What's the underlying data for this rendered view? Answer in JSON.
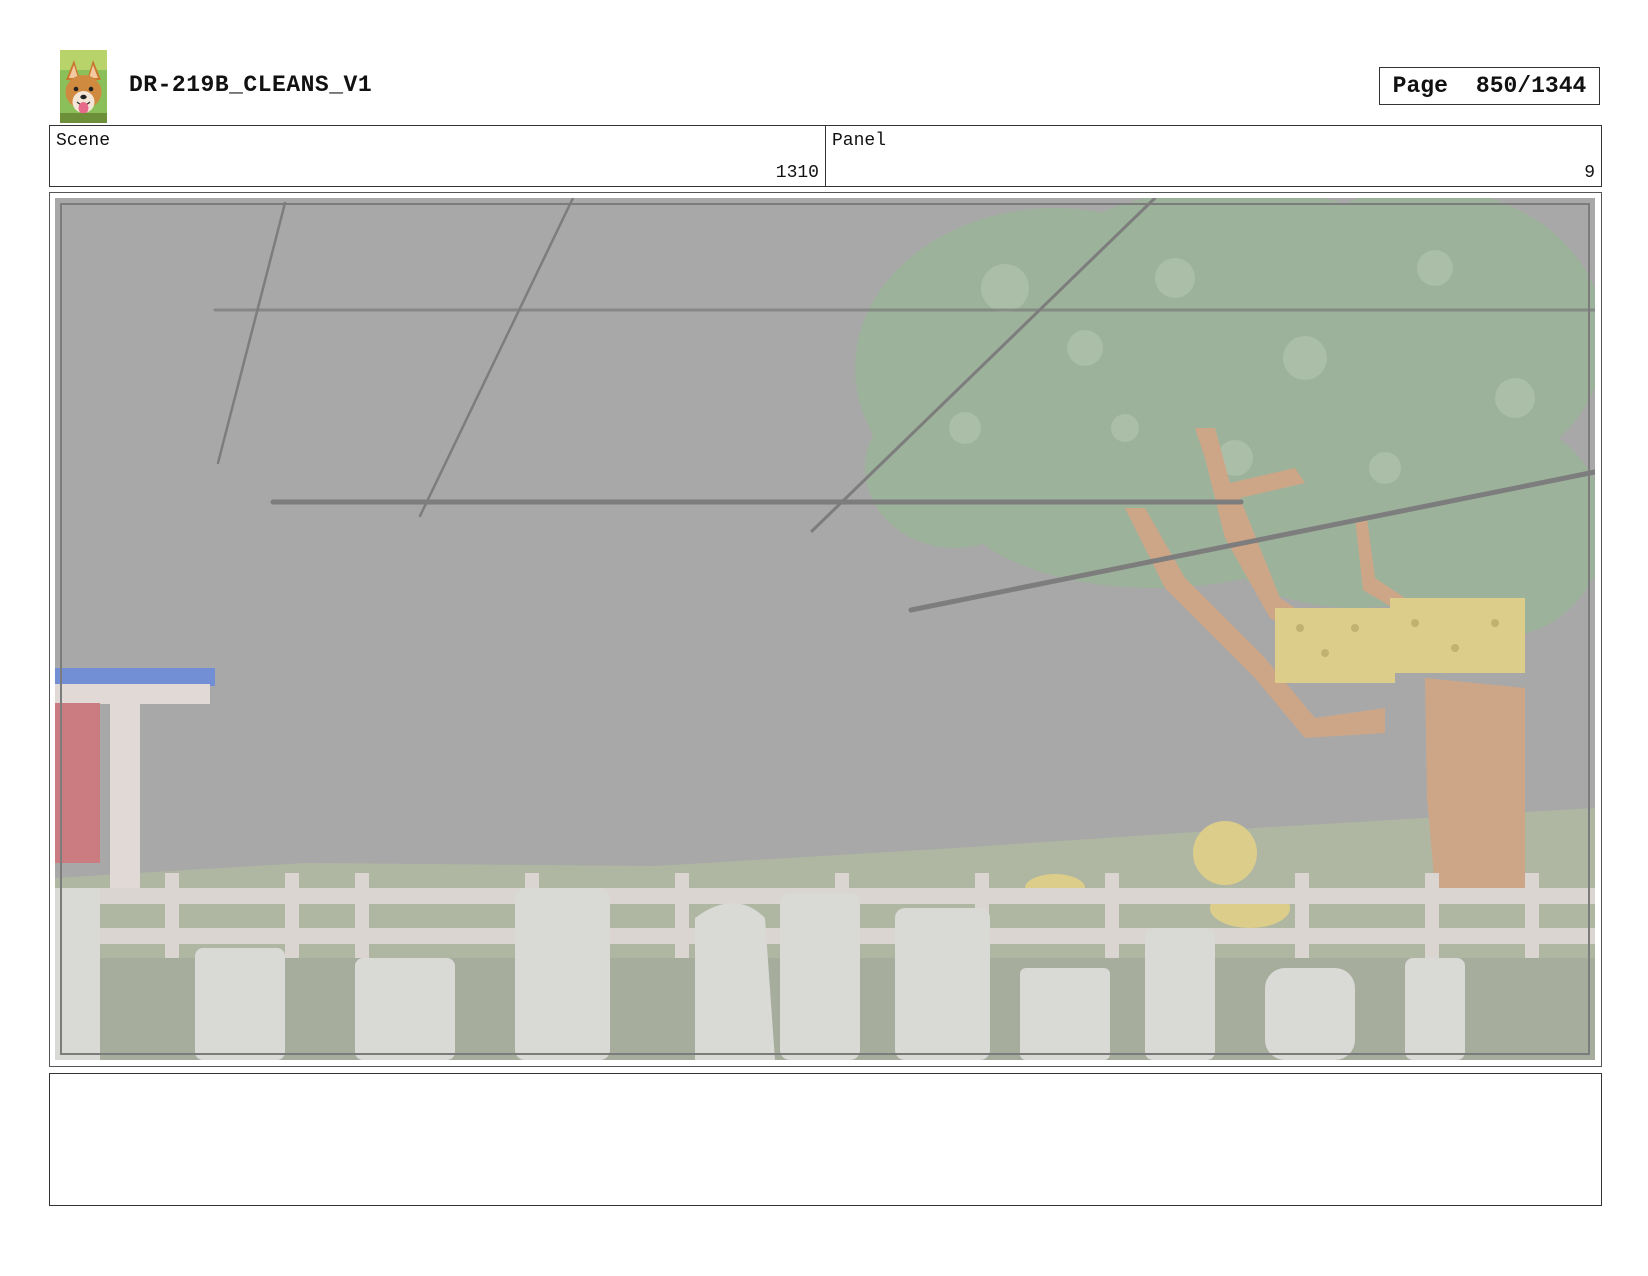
{
  "header": {
    "project_title": "DR-219B_CLEANS_V1",
    "page_label": "Page",
    "page_number": "850/1344"
  },
  "info": {
    "scene_label": "Scene",
    "scene_value": "1310",
    "panel_label": "Panel",
    "panel_value": "9"
  },
  "notes": {
    "text": ""
  },
  "colors": {
    "sky": "#9d9d9d",
    "grass": "#a4ad96",
    "foliage": "#8fa88c",
    "fence": "#d6d0cb",
    "tombstone": "#d4d4d0",
    "sign_blue": "#5f7fd0",
    "sign_red": "#c46a70",
    "hay": "#d8c77a",
    "trunk": "#c79a78"
  },
  "icons": {
    "logo": "dog-photo-logo"
  }
}
